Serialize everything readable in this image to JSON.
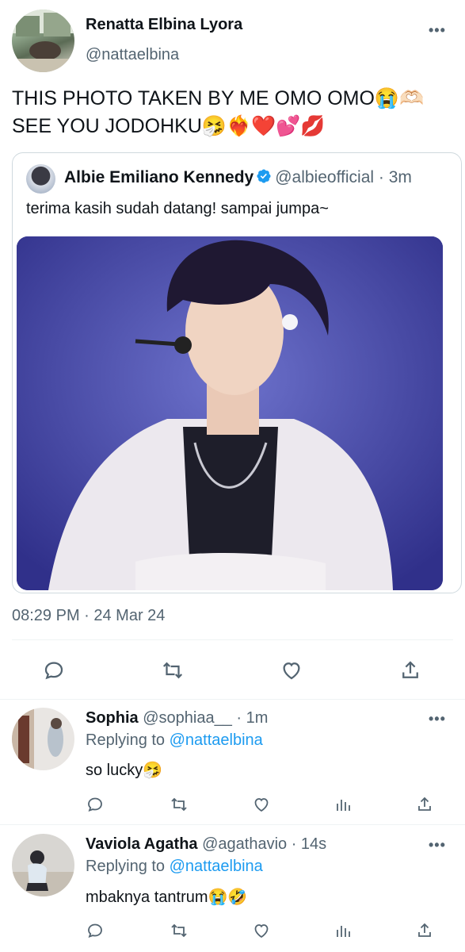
{
  "main_tweet": {
    "name": "Renatta Elbina Lyora",
    "handle": "@nattaelbina",
    "more": "•••",
    "text": "THIS PHOTO TAKEN BY ME OMO OMO😭🫶🏻 SEE YOU JODOHKU🤧❤️‍🔥❤️💕💋",
    "timestamp": "08:29 PM · 24 Mar 24"
  },
  "quoted_tweet": {
    "name": "Albie Emiliano Kennedy",
    "handle": "@albieofficial",
    "age": "· 3m",
    "text": "terima kasih sudah datang! sampai jumpa~"
  },
  "colors": {
    "link": "#1d9bf0",
    "muted": "#536471",
    "divider": "#eff3f4",
    "verified": "#1d9bf0"
  },
  "replies": [
    {
      "name": "Sophia",
      "handle": "@sophiaa__",
      "age": "· 1m",
      "replying_prefix": "Replying to",
      "replying_to": "@nattaelbina",
      "text": "so lucky🤧",
      "more": "•••"
    },
    {
      "name": "Vaviola Agatha",
      "handle": "@agathavio",
      "age": "· 14s",
      "replying_prefix": "Replying to",
      "replying_to": "@nattaelbina",
      "text": "mbaknya tantrum😭🤣",
      "more": "•••"
    }
  ],
  "icons": [
    "comment-icon",
    "retweet-icon",
    "like-icon",
    "share-icon",
    "analytics-icon",
    "more-icon",
    "verified-icon"
  ]
}
